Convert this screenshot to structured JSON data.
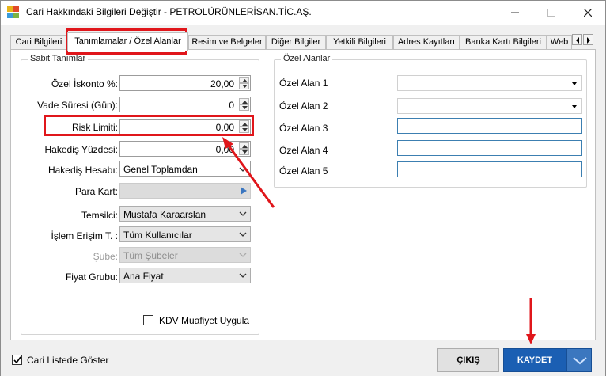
{
  "window": {
    "title": "Cari Hakkındaki Bilgileri Değiştir - PETROLÜRÜNLERİSAN.TİC.AŞ.",
    "app_icon": "colored-blocks-icon"
  },
  "tabs": [
    {
      "label": "Cari Bilgileri"
    },
    {
      "label": "Tanımlamalar / Özel Alanlar",
      "active": true
    },
    {
      "label": "Resim ve Belgeler"
    },
    {
      "label": "Diğer Bilgiler"
    },
    {
      "label": "Yetkili Bilgileri"
    },
    {
      "label": "Adres Kayıtları"
    },
    {
      "label": "Banka Kartı Bilgileri"
    },
    {
      "label": "Web"
    }
  ],
  "sabit": {
    "title": "Sabit Tanımlar",
    "ozel_iskonto_label": "Özel İskonto %:",
    "ozel_iskonto_value": "20,00",
    "vade_label": "Vade Süresi (Gün):",
    "vade_value": "0",
    "risk_label": "Risk Limiti:",
    "risk_value": "0,00",
    "hakedis_yuzde_label": "Hakediş Yüzdesi:",
    "hakedis_yuzde_value": "0,00",
    "hakedis_hesap_label": "Hakediş Hesabı:",
    "hakedis_hesap_value": "Genel Toplamdan",
    "para_kart_label": "Para Kart:",
    "temsilci_label": "Temsilci:",
    "temsilci_value": "Mustafa Karaarslan",
    "islem_label": "İşlem Erişim T. :",
    "islem_value": "Tüm Kullanıcılar",
    "sube_label": "Şube:",
    "sube_value": "Tüm Şubeler",
    "fiyat_label": "Fiyat Grubu:",
    "fiyat_value": "Ana Fiyat",
    "kdv_label": "KDV Muafiyet Uygula",
    "kdv_checked": false
  },
  "ozel": {
    "title": "Özel Alanlar",
    "alan1": "Özel Alan 1",
    "alan2": "Özel Alan 2",
    "alan3": "Özel Alan 3",
    "alan4": "Özel Alan 4",
    "alan5": "Özel Alan 5"
  },
  "footer": {
    "cari_listede_label": "Cari Listede Göster",
    "cari_listede_checked": true,
    "cikis_label": "ÇIKIŞ",
    "kaydet_label": "KAYDET"
  },
  "colors": {
    "highlight": "#e0161b",
    "primary_button": "#1b5fb3",
    "focus_border": "#3c7fb1"
  }
}
